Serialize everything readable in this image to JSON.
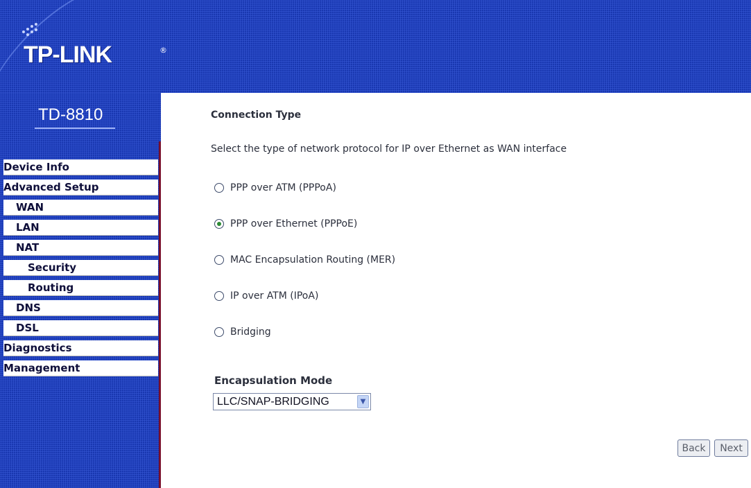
{
  "brand": {
    "logo_text": "TP-LINK",
    "registered": "®",
    "model": "TD-8810"
  },
  "sidebar": {
    "items": [
      {
        "label": "Device Info",
        "level": "top"
      },
      {
        "label": "Advanced Setup",
        "level": "top"
      },
      {
        "label": "WAN",
        "level": "sub"
      },
      {
        "label": "LAN",
        "level": "sub"
      },
      {
        "label": "NAT",
        "level": "sub"
      },
      {
        "label": "Security",
        "level": "sub"
      },
      {
        "label": "Routing",
        "level": "sub"
      },
      {
        "label": "DNS",
        "level": "sub"
      },
      {
        "label": "DSL",
        "level": "sub"
      },
      {
        "label": "Diagnostics",
        "level": "top"
      },
      {
        "label": "Management",
        "level": "top"
      }
    ]
  },
  "main": {
    "title": "Connection Type",
    "description": "Select the type of network protocol for IP over Ethernet as WAN interface",
    "options": [
      {
        "label": "PPP over ATM (PPPoA)",
        "checked": false
      },
      {
        "label": "PPP over Ethernet (PPPoE)",
        "checked": true
      },
      {
        "label": "MAC Encapsulation Routing (MER)",
        "checked": false
      },
      {
        "label": "IP over ATM (IPoA)",
        "checked": false
      },
      {
        "label": "Bridging",
        "checked": false
      }
    ],
    "encapsulation": {
      "label": "Encapsulation Mode",
      "value": "LLC/SNAP-BRIDGING"
    },
    "buttons": {
      "back": "Back",
      "next": "Next"
    }
  },
  "colors": {
    "background_blue": "#1d3fc4",
    "sidebar_edge": "#7a0f2b",
    "radio_selected": "#2c8a34"
  },
  "icons": {
    "dropdown": "chevron-down-icon"
  }
}
